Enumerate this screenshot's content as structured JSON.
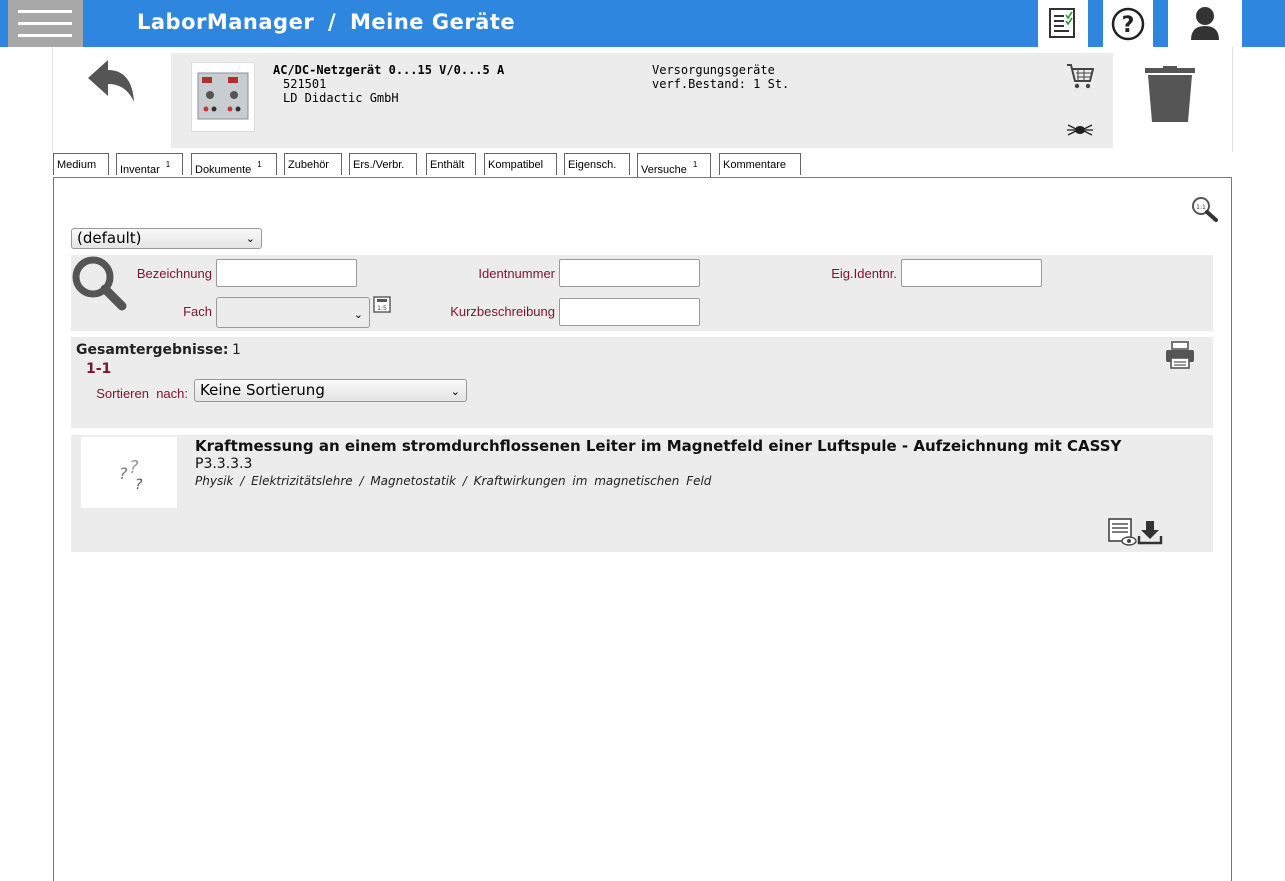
{
  "header": {
    "app_name": "LaborManager",
    "separator": "/",
    "page_name": "Meine Geräte"
  },
  "icons": {
    "menu": "hamburger-menu-icon",
    "checklist": "checklist-icon",
    "help": "help-icon",
    "user": "user-icon",
    "back": "back-arrow-icon",
    "cart": "shopping-cart-icon",
    "bug": "bug-icon",
    "trash": "trash-icon",
    "zoom": "magnifier-icon",
    "search": "search-icon",
    "calculator": "calculator-icon",
    "print": "printer-icon",
    "preview": "document-preview-icon",
    "download": "download-icon"
  },
  "device": {
    "name": "AC/DC-Netzgerät 0...15 V/0...5 A",
    "number": "521501",
    "manufacturer": "LD Didactic GmbH",
    "category": "Versorgungsgeräte",
    "stock": "verf.Bestand: 1 St."
  },
  "tabs": [
    {
      "label": "Medium",
      "badge": ""
    },
    {
      "label": "Inventar",
      "badge": "1"
    },
    {
      "label": "Dokumente",
      "badge": "1"
    },
    {
      "label": "Zubehör",
      "badge": ""
    },
    {
      "label": "Ers./Verbr.",
      "badge": ""
    },
    {
      "label": "Enthält",
      "badge": ""
    },
    {
      "label": "Kompatibel",
      "badge": ""
    },
    {
      "label": "Eigensch.",
      "badge": ""
    },
    {
      "label": "Versuche",
      "badge": "1"
    },
    {
      "label": "Kommentare",
      "badge": ""
    }
  ],
  "active_tab": "Versuche",
  "filter": {
    "preset_value": "(default)",
    "bezeichnung_label": "Bezeichnung",
    "identnummer_label": "Identnummer",
    "eig_identnr_label": "Eig.Identnr.",
    "fach_label": "Fach",
    "kurzbeschreibung_label": "Kurzbeschreibung",
    "bezeichnung_value": "",
    "identnummer_value": "",
    "eig_identnr_value": "",
    "fach_value": "",
    "kurzbeschreibung_value": ""
  },
  "results": {
    "total_label": "Gesamtergebnisse:",
    "total_count": "1",
    "range": "1-1",
    "sort_label": "Sortieren  nach:",
    "sort_value": "Keine Sortierung"
  },
  "items": [
    {
      "title": "Kraftmessung an einem stromdurchflossenen Leiter im Magnetfeld einer Luftspule - Aufzeichnung mit CASSY",
      "code": "P3.3.3.3",
      "path": "Physik / Elektrizitätslehre / Magnetostatik / Kraftwirkungen im magnetischen Feld"
    }
  ],
  "colors": {
    "topbar": "#2e86de",
    "label_text": "#7a1430",
    "panel_bg": "#ececec"
  }
}
